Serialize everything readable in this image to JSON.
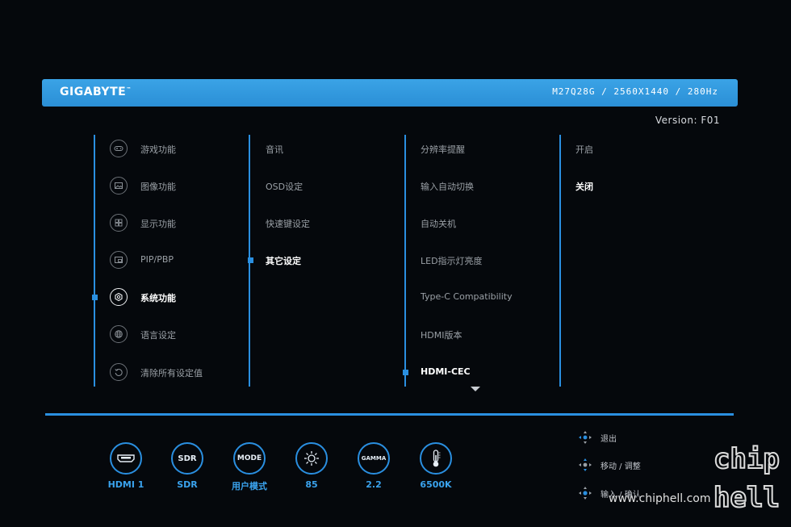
{
  "header": {
    "brand": "GIGABYTE",
    "brand_mark": "™",
    "model": "M27Q28G / 2560X1440 / 280Hz",
    "version": "Version: F01"
  },
  "column1": {
    "items": [
      {
        "label": "游戏功能",
        "icon": "gamepad-icon"
      },
      {
        "label": "图像功能",
        "icon": "picture-icon"
      },
      {
        "label": "显示功能",
        "icon": "grid-icon"
      },
      {
        "label": "PIP/PBP",
        "icon": "pip-icon"
      },
      {
        "label": "系统功能",
        "icon": "system-gear-icon"
      },
      {
        "label": "语言设定",
        "icon": "globe-icon"
      },
      {
        "label": "清除所有设定值",
        "icon": "reset-icon"
      }
    ],
    "active_index": 4
  },
  "column2": {
    "items": [
      "音讯",
      "OSD设定",
      "快速键设定",
      "其它设定"
    ],
    "active_index": 3
  },
  "column3": {
    "items": [
      "分辨率提醒",
      "输入自动切换",
      "自动关机",
      "LED指示灯亮度",
      "Type-C Compatibility",
      "HDMI版本",
      "HDMI-CEC"
    ],
    "active_index": 6
  },
  "column4": {
    "items": [
      "开启",
      "关闭"
    ],
    "selected_index": 1
  },
  "status": [
    {
      "symbol": "",
      "label": "HDMI 1",
      "icon": "hdmi-icon"
    },
    {
      "symbol": "SDR",
      "label": "SDR",
      "icon": "sdr-icon"
    },
    {
      "symbol": "MODE",
      "label": "用户模式",
      "icon": "mode-icon"
    },
    {
      "symbol": "",
      "label": "85",
      "icon": "brightness-icon"
    },
    {
      "symbol": "GAMMA",
      "label": "2.2",
      "icon": "gamma-icon"
    },
    {
      "symbol": "",
      "label": "6500K",
      "icon": "thermometer-icon"
    }
  ],
  "hints": [
    {
      "label": "退出",
      "icon": "joystick-left-icon"
    },
    {
      "label": "移动 / 调整",
      "icon": "joystick-updown-icon"
    },
    {
      "label": "输入 / 确认",
      "icon": "joystick-press-icon"
    }
  ],
  "watermark": {
    "text": "www.chiphell.com",
    "logo_lines": [
      "chip",
      "hell"
    ]
  },
  "colors": {
    "accent": "#2a8fe0",
    "header": "#3aa3e6",
    "background": "#05080c"
  }
}
